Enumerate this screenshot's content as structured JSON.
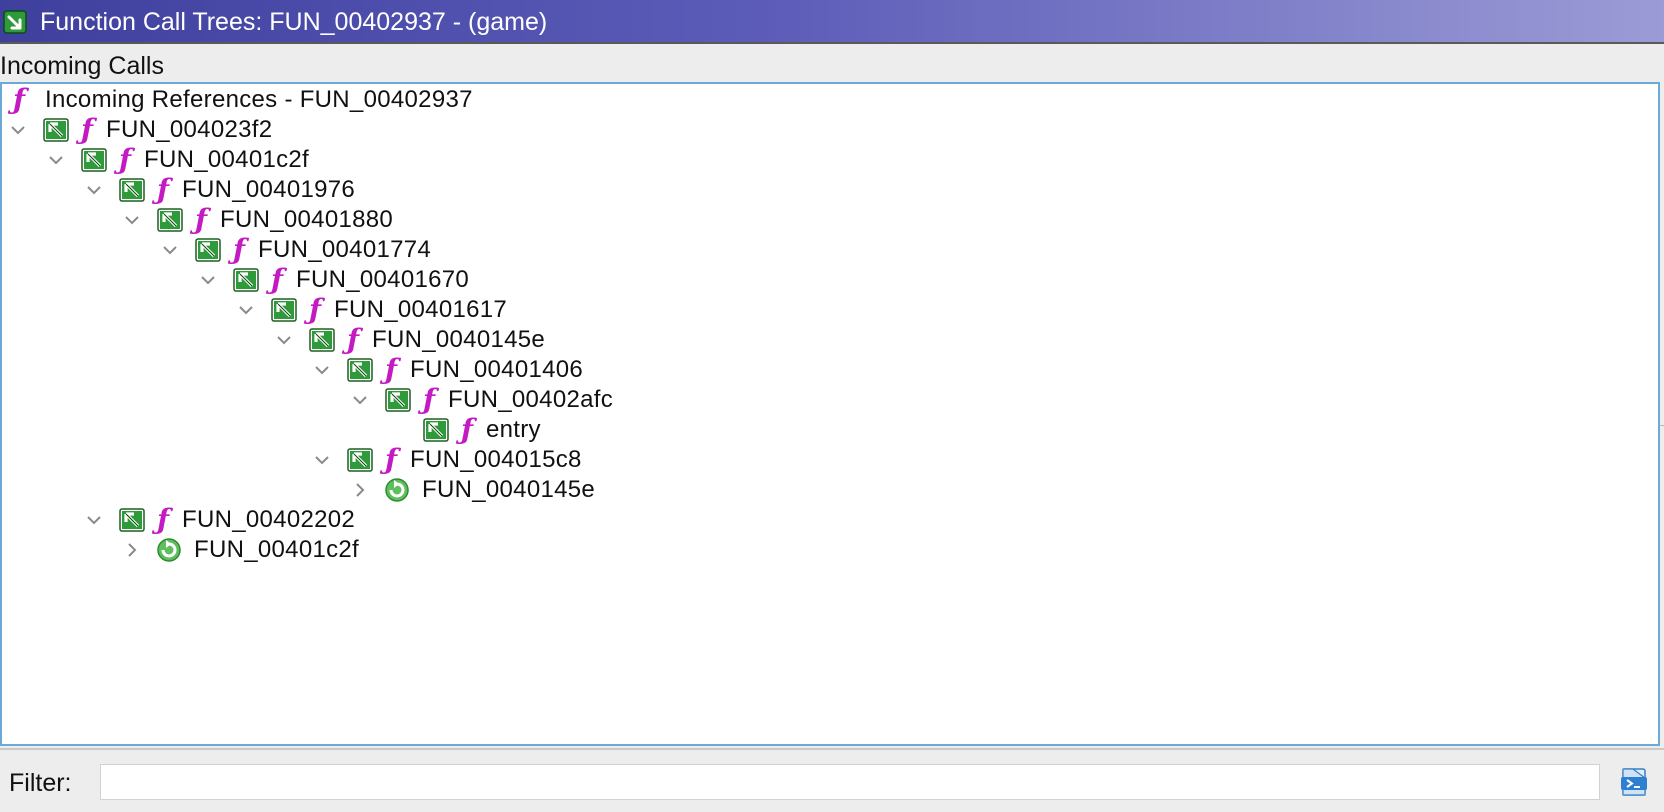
{
  "window": {
    "title": "Function Call Trees: FUN_00402937 -  (game)",
    "title_icon": "call-tree-icon"
  },
  "section_label": "Incoming Calls",
  "tree": {
    "root": {
      "label": "Incoming References - FUN_00402937",
      "icon": "function-icon"
    },
    "nodes": [
      {
        "label": "FUN_004023f2",
        "expanded": true,
        "icon": "incoming-call-icon"
      },
      {
        "label": "FUN_00401c2f",
        "expanded": true,
        "icon": "incoming-call-icon"
      },
      {
        "label": "FUN_00401976",
        "expanded": true,
        "icon": "incoming-call-icon"
      },
      {
        "label": "FUN_00401880",
        "expanded": true,
        "icon": "incoming-call-icon"
      },
      {
        "label": "FUN_00401774",
        "expanded": true,
        "icon": "incoming-call-icon"
      },
      {
        "label": "FUN_00401670",
        "expanded": true,
        "icon": "incoming-call-icon"
      },
      {
        "label": "FUN_00401617",
        "expanded": true,
        "icon": "incoming-call-icon"
      },
      {
        "label": "FUN_0040145e",
        "expanded": true,
        "icon": "incoming-call-icon"
      },
      {
        "label": "FUN_00401406",
        "expanded": true,
        "icon": "incoming-call-icon"
      },
      {
        "label": "FUN_00402afc",
        "expanded": true,
        "icon": "incoming-call-icon"
      },
      {
        "label": "entry",
        "expanded": null,
        "icon": "incoming-call-icon"
      },
      {
        "label": "FUN_004015c8",
        "expanded": true,
        "icon": "incoming-call-icon"
      },
      {
        "label": "FUN_0040145e",
        "expanded": false,
        "icon": "recursive-reference-icon"
      },
      {
        "label": "FUN_00402202",
        "expanded": true,
        "icon": "incoming-call-icon"
      },
      {
        "label": "FUN_00401c2f",
        "expanded": false,
        "icon": "recursive-reference-icon"
      }
    ]
  },
  "filter": {
    "label": "Filter:",
    "value": "",
    "placeholder": ""
  },
  "colors": {
    "title_gradient_start": "#3f3f9e",
    "title_gradient_end": "#9b9bd6",
    "function_icon": "#c41ac4",
    "call_icon_green": "#2e9a3a",
    "tree_border": "#6aa9d8"
  }
}
